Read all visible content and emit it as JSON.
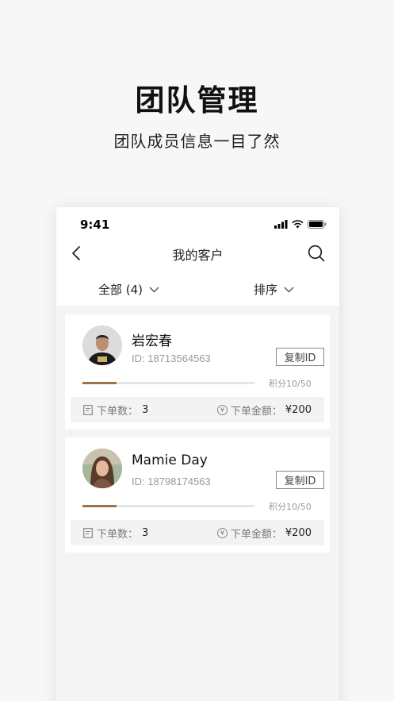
{
  "promo": {
    "title": "团队管理",
    "subtitle": "团队成员信息一目了然"
  },
  "status_bar": {
    "time": "9:41",
    "icons": [
      "signal-icon",
      "wifi-icon",
      "battery-icon"
    ]
  },
  "nav": {
    "back_icon": "chevron-left-icon",
    "title": "我的客户",
    "search_icon": "search-icon"
  },
  "filters": {
    "all_label": "全部 (4)",
    "sort_label": "排序",
    "chevron_icon": "chevron-down-icon"
  },
  "customers": [
    {
      "name": "岩宏春",
      "id_text": "ID: 18713564563",
      "copy_label": "复制ID",
      "points_text": "积分10/50",
      "progress": 0.2,
      "orders_label": "下单数：",
      "orders_value": "3",
      "amount_label": "下单金额：",
      "amount_value": "¥200"
    },
    {
      "name": "Mamie Day",
      "id_text": "ID: 18798174563",
      "copy_label": "复制ID",
      "points_text": "积分10/50",
      "progress": 0.2,
      "orders_label": "下单数：",
      "orders_value": "3",
      "amount_label": "下单金额：",
      "amount_value": "¥200"
    }
  ],
  "colors": {
    "progress": "#9c7248",
    "page_bg": "#f7f7f7"
  }
}
